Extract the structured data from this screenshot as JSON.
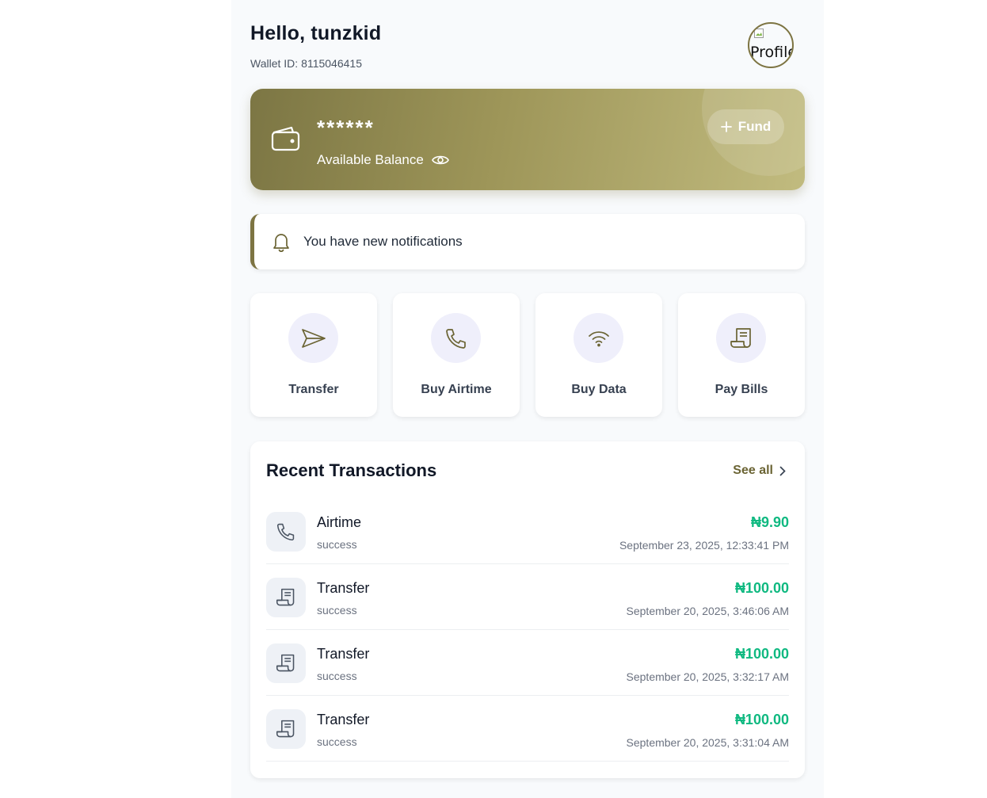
{
  "header": {
    "greeting": "Hello, tunzkid",
    "wallet_id_label": "Wallet ID:",
    "wallet_id": "8115046415",
    "avatar_alt": "Profile"
  },
  "balance": {
    "masked_amount": "******",
    "label": "Available Balance",
    "fund_label": "Fund"
  },
  "notification": {
    "text": "You have new notifications"
  },
  "actions": [
    {
      "label": "Transfer",
      "icon": "send-icon"
    },
    {
      "label": "Buy Airtime",
      "icon": "phone-icon"
    },
    {
      "label": "Buy Data",
      "icon": "wifi-icon"
    },
    {
      "label": "Pay Bills",
      "icon": "receipt-icon"
    }
  ],
  "transactions": {
    "title": "Recent Transactions",
    "see_all": "See all",
    "items": [
      {
        "name": "Airtime",
        "status": "success",
        "amount": "₦9.90",
        "date": "September 23, 2025, 12:33:41 PM",
        "icon": "phone-icon"
      },
      {
        "name": "Transfer",
        "status": "success",
        "amount": "₦100.00",
        "date": "September 20, 2025, 3:46:06 AM",
        "icon": "receipt-icon"
      },
      {
        "name": "Transfer",
        "status": "success",
        "amount": "₦100.00",
        "date": "September 20, 2025, 3:32:17 AM",
        "icon": "receipt-icon"
      },
      {
        "name": "Transfer",
        "status": "success",
        "amount": "₦100.00",
        "date": "September 20, 2025, 3:31:04 AM",
        "icon": "receipt-icon"
      }
    ]
  },
  "colors": {
    "accent": "#7d7442",
    "card_start": "#7c7644",
    "card_end": "#c1bb7f",
    "amount_green": "#10b981",
    "action_circle": "#efeffb"
  }
}
